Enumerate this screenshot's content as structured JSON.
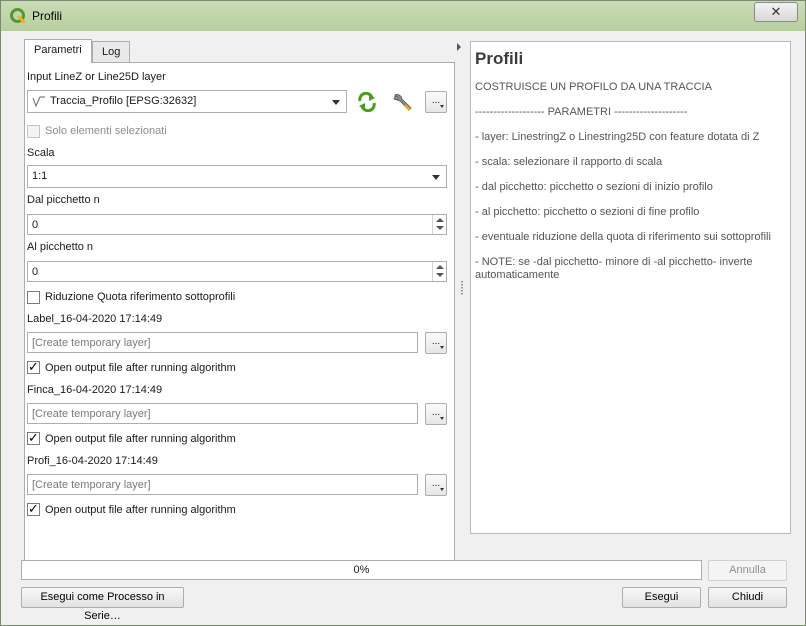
{
  "window": {
    "title": "Profili",
    "close_glyph": "✕"
  },
  "tabs": [
    {
      "label": "Parametri",
      "active": true
    },
    {
      "label": "Log",
      "active": false
    }
  ],
  "params": {
    "input_layer_label": "Input LineZ or Line25D layer",
    "input_layer_value": "Traccia_Profilo [EPSG:32632]",
    "input_layer_icon": "line-layer-icon",
    "iterate_icon": "iterate-icon",
    "wrench_icon": "wrench-icon",
    "browse_label": "...",
    "selected_only_label": "Solo elementi selezionati",
    "selected_only_checked": false,
    "scale_label": "Scala",
    "scale_value": "1:1",
    "from_label": "Dal picchetto n",
    "from_value": "0",
    "to_label": "Al picchetto n",
    "to_value": "0",
    "reduction_label": "Riduzione Quota riferimento sottoprofili",
    "reduction_checked": false,
    "outputs": [
      {
        "label": "Label_16-04-2020 17:14:49",
        "placeholder": "[Create temporary layer]",
        "open_label": "Open output file after running algorithm",
        "open_checked": true
      },
      {
        "label": "Finca_16-04-2020 17:14:49",
        "placeholder": "[Create temporary layer]",
        "open_label": "Open output file after running algorithm",
        "open_checked": true
      },
      {
        "label": "Profi_16-04-2020 17:14:49",
        "placeholder": "[Create temporary layer]",
        "open_label": "Open output file after running algorithm",
        "open_checked": true
      }
    ],
    "check_glyph": "✓"
  },
  "help": {
    "title": "Profili",
    "lines": [
      "COSTRUISCE UN PROFILO DA UNA TRACCIA",
      "------------------- PARAMETRI --------------------",
      "- layer: LinestringZ o Linestring25D con feature dotata di Z",
      "- scala: selezionare il rapporto di scala",
      "- dal picchetto: picchetto o sezioni di inizio profilo",
      "- al picchetto: picchetto o sezioni di fine profilo",
      "- eventuale riduzione della quota di riferimento sui sottoprofili",
      "- NOTE: se -dal picchetto- minore di -al picchetto- inverte automaticamente"
    ]
  },
  "progress": {
    "text": "0%",
    "value": 0
  },
  "buttons": {
    "cancel": "Annulla",
    "batch": "Esegui come Processo in Serie…",
    "run": "Esegui",
    "close": "Chiudi"
  },
  "colors": {
    "accent": "#589632",
    "progress_fill": "#06b025"
  }
}
